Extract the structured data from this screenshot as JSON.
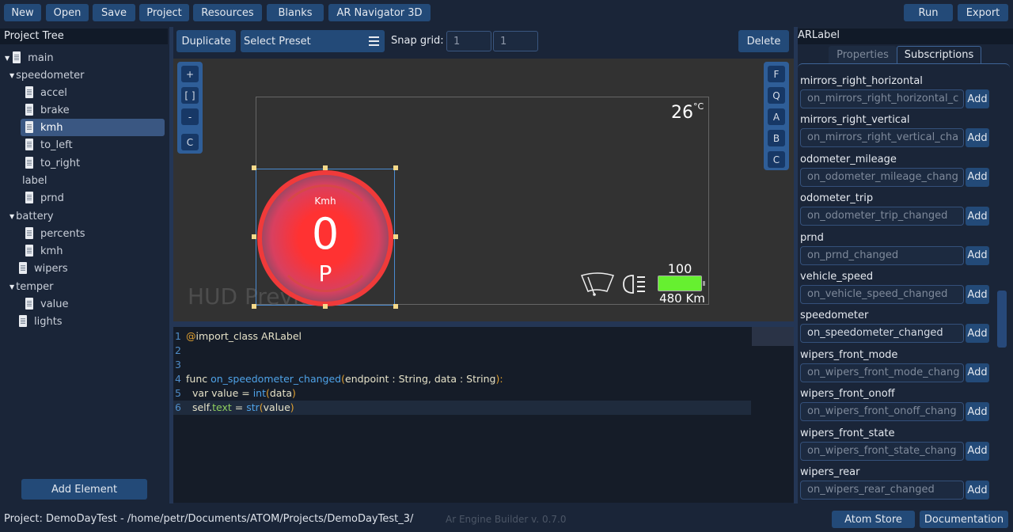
{
  "toolbar": {
    "new": "New",
    "open": "Open",
    "save": "Save",
    "project": "Project",
    "resources": "Resources",
    "blanks": "Blanks",
    "ar_navigator": "AR Navigator 3D",
    "run": "Run",
    "export": "Export"
  },
  "project_tree": {
    "title": "Project Tree",
    "items": [
      {
        "label": "main",
        "depth": 0,
        "icon": "document-icon",
        "expanded": true
      },
      {
        "label": "speedometer",
        "depth": 1,
        "icon": null,
        "expanded": true
      },
      {
        "label": "accel",
        "depth": 2,
        "icon": "document-icon"
      },
      {
        "label": "brake",
        "depth": 2,
        "icon": "document-icon"
      },
      {
        "label": "kmh",
        "depth": 2,
        "icon": "document-icon",
        "selected": true
      },
      {
        "label": "to_left",
        "depth": 2,
        "icon": "document-icon"
      },
      {
        "label": "to_right",
        "depth": 2,
        "icon": "document-icon"
      },
      {
        "label": "label",
        "depth": 2,
        "icon": null
      },
      {
        "label": "prnd",
        "depth": 2,
        "icon": "document-icon"
      },
      {
        "label": "battery",
        "depth": 1,
        "icon": null,
        "expanded": true
      },
      {
        "label": "percents",
        "depth": 2,
        "icon": "document-icon"
      },
      {
        "label": "kmh",
        "depth": 2,
        "icon": "document-icon"
      },
      {
        "label": "wipers",
        "depth": 1,
        "icon": "document-icon"
      },
      {
        "label": "temper",
        "depth": 1,
        "icon": null,
        "expanded": true
      },
      {
        "label": "value",
        "depth": 2,
        "icon": "document-icon"
      },
      {
        "label": "lights",
        "depth": 1,
        "icon": "document-icon"
      }
    ],
    "add_element": "Add Element"
  },
  "editor_toolbar": {
    "duplicate": "Duplicate",
    "preset_value": "Select Preset",
    "snap_label": "Snap grid:",
    "snap_x": "1",
    "snap_y": "1",
    "delete": "Delete"
  },
  "canvas": {
    "zoom_tools": [
      "+",
      "[ ]",
      "-",
      "C"
    ],
    "view_tools": [
      "F",
      "Q",
      "A",
      "B",
      "C"
    ],
    "watermark": "HUD Preview",
    "hud": {
      "temperature": "26",
      "temperature_unit": "°C",
      "speed_unit": "Kmh",
      "speed": "0",
      "gear": "P",
      "battery_percent": "100",
      "battery_level": 1.0,
      "range": "480 Km",
      "battery_color": "#66f030",
      "gauge_color": "#ff3030",
      "icons": [
        "wiper-icon",
        "headlight-icon",
        "battery-icon"
      ]
    }
  },
  "code": {
    "lines": [
      {
        "n": "1",
        "tokens": [
          {
            "t": "@",
            "c": "#e0a030"
          },
          {
            "t": "import_class ARLabel",
            "c": "#e6e2c8"
          }
        ]
      },
      {
        "n": "2",
        "tokens": []
      },
      {
        "n": "3",
        "tokens": []
      },
      {
        "n": "4",
        "tokens": [
          {
            "t": "func ",
            "c": "#e6e2c8"
          },
          {
            "t": "on_speedometer_changed",
            "c": "#4fa3e8"
          },
          {
            "t": "(",
            "c": "#e0a030"
          },
          {
            "t": "endpoint : String, data : String",
            "c": "#e6e2c8"
          },
          {
            "t": "):",
            "c": "#e0a030"
          }
        ]
      },
      {
        "n": "5",
        "tokens": [
          {
            "t": "  var value = ",
            "c": "#e6e2c8"
          },
          {
            "t": "int",
            "c": "#4fa3e8"
          },
          {
            "t": "(",
            "c": "#e0a030"
          },
          {
            "t": "data",
            "c": "#e6e2c8"
          },
          {
            "t": ")",
            "c": "#e0a030"
          }
        ]
      },
      {
        "n": "6",
        "tokens": [
          {
            "t": "  self.",
            "c": "#e6e2c8"
          },
          {
            "t": "text",
            "c": "#8fce5f"
          },
          {
            "t": " = ",
            "c": "#e6e2c8"
          },
          {
            "t": "str",
            "c": "#4fa3e8"
          },
          {
            "t": "(",
            "c": "#e0a030"
          },
          {
            "t": "value",
            "c": "#e6e2c8"
          },
          {
            "t": ")",
            "c": "#e0a030"
          }
        ]
      }
    ]
  },
  "inspector": {
    "title": "ARLabel",
    "tabs": [
      {
        "label": "Properties",
        "active": false
      },
      {
        "label": "Subscriptions",
        "active": true
      }
    ],
    "subscriptions": [
      {
        "name": "mirrors_right_horizontal",
        "handler": "on_mirrors_right_horizontal_c"
      },
      {
        "name": "mirrors_right_vertical",
        "handler": "on_mirrors_right_vertical_cha"
      },
      {
        "name": "odometer_mileage",
        "handler": "on_odometer_mileage_chang"
      },
      {
        "name": "odometer_trip",
        "handler": "on_odometer_trip_changed"
      },
      {
        "name": "prnd",
        "handler": "on_prnd_changed"
      },
      {
        "name": "vehicle_speed",
        "handler": "on_vehicle_speed_changed"
      },
      {
        "name": "speedometer",
        "handler": "on_speedometer_changed",
        "active": true
      },
      {
        "name": "wipers_front_mode",
        "handler": "on_wipers_front_mode_chang"
      },
      {
        "name": "wipers_front_onoff",
        "handler": "on_wipers_front_onoff_chang"
      },
      {
        "name": "wipers_front_state",
        "handler": "on_wipers_front_state_chang"
      },
      {
        "name": "wipers_rear",
        "handler": "on_wipers_rear_changed"
      }
    ],
    "add_label": "Add"
  },
  "status": {
    "project_info": "Project: DemoDayTest - /home/petr/Documents/ATOM/Projects/DemoDayTest_3/",
    "version": "Ar Engine Builder v. 0.7.0",
    "atom_store": "Atom Store",
    "documentation": "Documentation"
  }
}
